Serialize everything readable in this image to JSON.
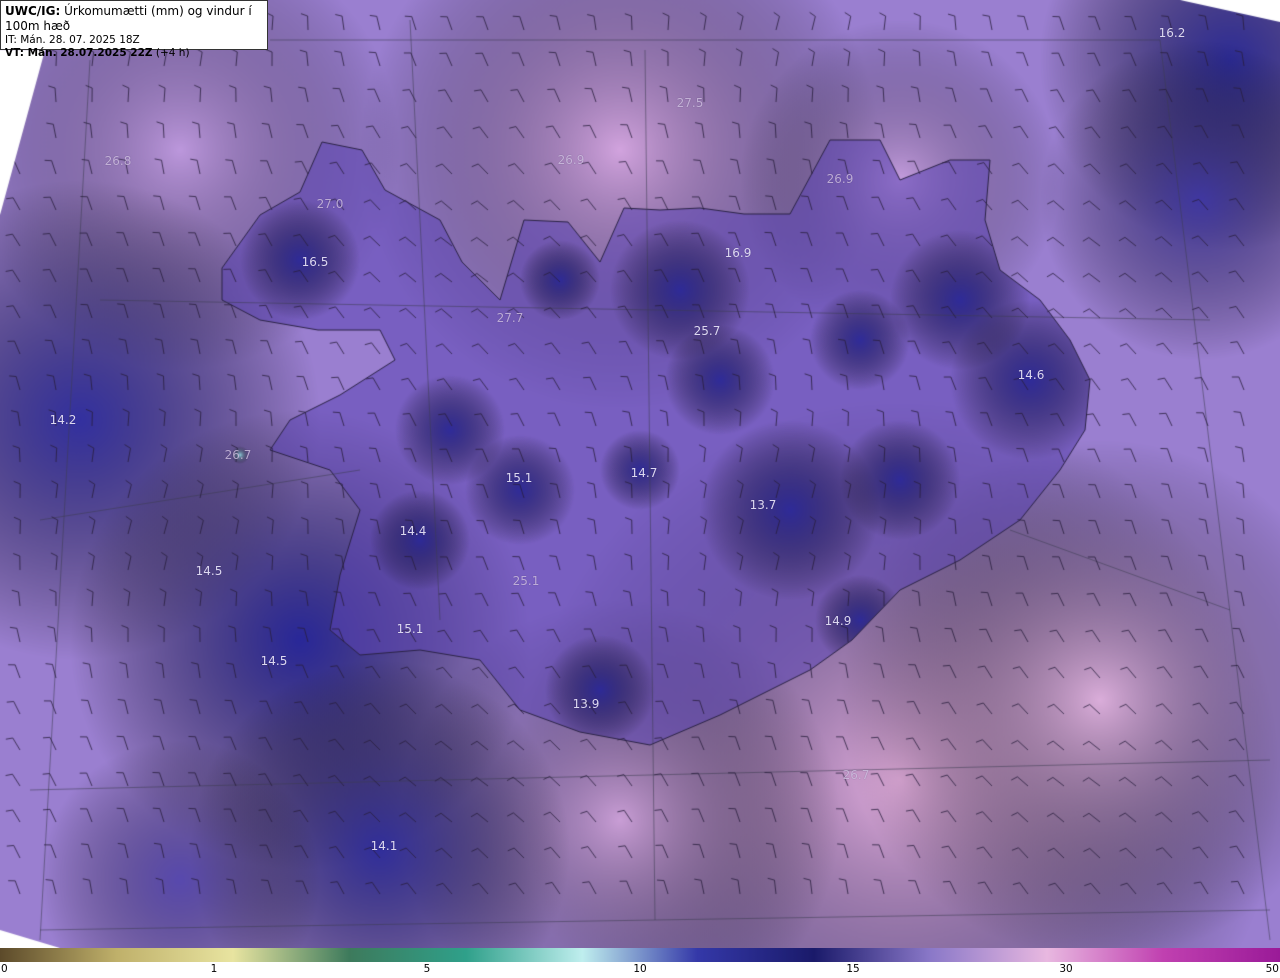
{
  "header": {
    "model": "UWC/IG:",
    "title": "Úrkomumætti (mm) og vindur í 100m hæð",
    "init_time": "IT: Mán. 28. 07. 2025 18Z",
    "valid_label": "VT: Mán. 28.07.2025 22Z",
    "lead": "(+4 h)"
  },
  "map": {
    "land_color": "#24215e",
    "values": [
      {
        "text": "16.2",
        "faint": false
      },
      {
        "text": "27.5",
        "faint": true
      },
      {
        "text": "26.8",
        "faint": true
      },
      {
        "text": "26.9",
        "faint": true
      },
      {
        "text": "26.9",
        "faint": true
      },
      {
        "text": "27.0",
        "faint": true
      },
      {
        "text": "16.5",
        "faint": false
      },
      {
        "text": "16.9",
        "faint": false
      },
      {
        "text": "25.7",
        "faint": false
      },
      {
        "text": "27.7",
        "faint": true
      },
      {
        "text": "14.6",
        "faint": false
      },
      {
        "text": "14.2",
        "faint": false
      },
      {
        "text": "15.1",
        "faint": false
      },
      {
        "text": "14.7",
        "faint": false
      },
      {
        "text": "13.7",
        "faint": false
      },
      {
        "text": "14.4",
        "faint": false
      },
      {
        "text": "14.5",
        "faint": false
      },
      {
        "text": "25.1",
        "faint": true
      },
      {
        "text": "15.1",
        "faint": false
      },
      {
        "text": "14.9",
        "faint": false
      },
      {
        "text": "14.5",
        "faint": false
      },
      {
        "text": "13.9",
        "faint": false
      },
      {
        "text": "26.7",
        "faint": true
      },
      {
        "text": "14.1",
        "faint": false
      },
      {
        "text": "26.7",
        "faint": true
      }
    ]
  },
  "colorbar": {
    "ticks": [
      "0",
      "1",
      "5",
      "10",
      "15",
      "30",
      "50"
    ],
    "colors": [
      "#5c4a2a",
      "#bfb06a",
      "#e8e4a0",
      "#3d7a5c",
      "#2fa08a",
      "#bfeeee",
      "#3438a8",
      "#1a1a6a",
      "#8a78c8",
      "#e8b8e0",
      "#c040b0",
      "#9a1a98"
    ]
  }
}
